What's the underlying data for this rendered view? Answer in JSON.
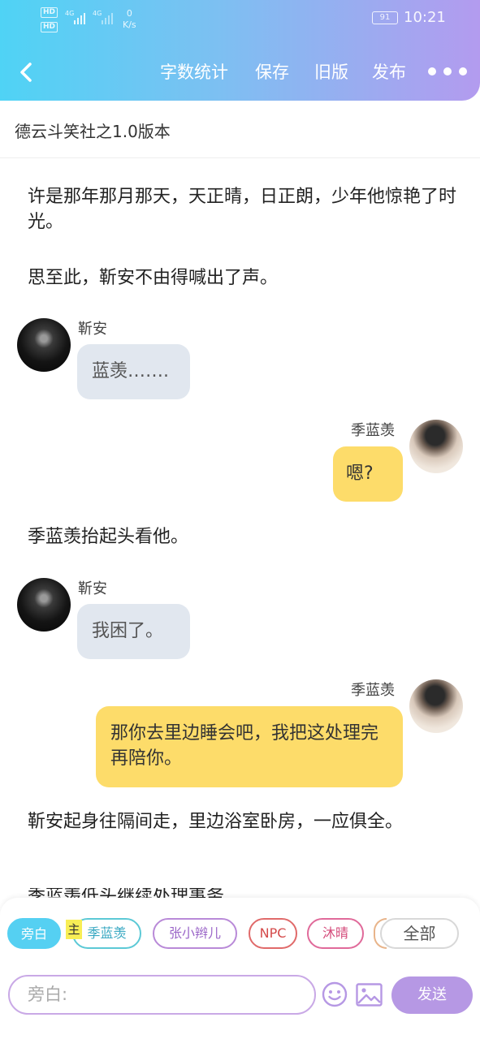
{
  "status_bar": {
    "hd_label": "HD",
    "signal_label": "4G",
    "speed_value": "0",
    "speed_unit": "K/s",
    "battery": "91",
    "time": "10:21"
  },
  "nav": {
    "word_count": "字数统计",
    "save": "保存",
    "old_version": "旧版",
    "publish": "发布"
  },
  "document": {
    "title": "德云斗笑社之1.0版本"
  },
  "story": [
    {
      "type": "narration",
      "text": "许是那年那月那天，天正晴，日正朗，少年他惊艳了时光。"
    },
    {
      "type": "narration",
      "text": "思至此，靳安不由得喊出了声。"
    },
    {
      "type": "message",
      "side": "left",
      "speaker": "靳安",
      "text": "蓝羡……."
    },
    {
      "type": "message",
      "side": "right",
      "speaker": "季蓝羡",
      "text": "嗯?"
    },
    {
      "type": "narration",
      "text": "季蓝羡抬起头看他。"
    },
    {
      "type": "message",
      "side": "left",
      "speaker": "靳安",
      "text": "我困了。"
    },
    {
      "type": "message",
      "side": "right",
      "speaker": "季蓝羡",
      "text": "那你去里边睡会吧，我把这处理完再陪你。"
    },
    {
      "type": "narration",
      "text": "靳安起身往隔间走，里边浴室卧房，一应俱全。"
    },
    {
      "type": "narration",
      "text": "季蓝羡低头继续处理事务"
    }
  ],
  "roles": {
    "narrator": "旁白",
    "main_tag": "主",
    "ji": "季蓝羡",
    "zhang": "张小辫儿",
    "npc": "NPC",
    "mu": "沐晴",
    "all": "全部"
  },
  "composer": {
    "placeholder": "旁白:",
    "send": "发送"
  },
  "colors": {
    "header_start": "#4fd3f5",
    "header_end": "#b39bef",
    "bubble_left": "#e1e7ef",
    "bubble_right": "#fddc6a",
    "send_button": "#b698e4"
  }
}
